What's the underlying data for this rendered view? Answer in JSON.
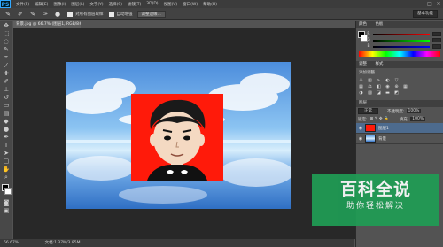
{
  "menubar": {
    "logo": "PS",
    "items": [
      "文件(F)",
      "编辑(E)",
      "图像(I)",
      "图层(L)",
      "文字(Y)",
      "选择(S)",
      "滤镜(T)",
      "3D(D)",
      "视图(V)",
      "窗口(W)",
      "帮助(H)"
    ]
  },
  "options": {
    "icons": [
      "brush-icon",
      "brush-add-icon",
      "brush-subtract-icon"
    ],
    "sample_all": "对所有图层取样",
    "auto_enhance": "自动增强",
    "refine_edge": "调整边缘...",
    "workspace": "基本功能"
  },
  "document": {
    "tab_title": "背景.jpg @ 66.7% (图层1, RGB/8#) *",
    "zoom": "66.67%",
    "doc_size": "文档:1.37M/3.85M"
  },
  "panels": {
    "color_tab": "颜色",
    "swatches_tab": "色板",
    "channels": [
      "R",
      "G",
      "B"
    ],
    "adjustments_tab": "调整",
    "styles_tab": "样式",
    "add_adjustment": "添加调整",
    "layers_tab": "图层",
    "blend_mode": "正常",
    "opacity_label": "不透明度:",
    "opacity_value": "100%",
    "lock_label": "锁定:",
    "fill_label": "填充:",
    "fill_value": "100%",
    "layers": [
      {
        "name": "图层1",
        "selected": true
      },
      {
        "name": "背景",
        "selected": false
      }
    ]
  },
  "watermark": {
    "title": "百科全说",
    "subtitle": "助你轻松解决"
  },
  "colors": {
    "accent_red": "#ff1a0a",
    "sky": "#5b9be0",
    "panel": "#535353",
    "watermark_green": "#1f9d55"
  }
}
